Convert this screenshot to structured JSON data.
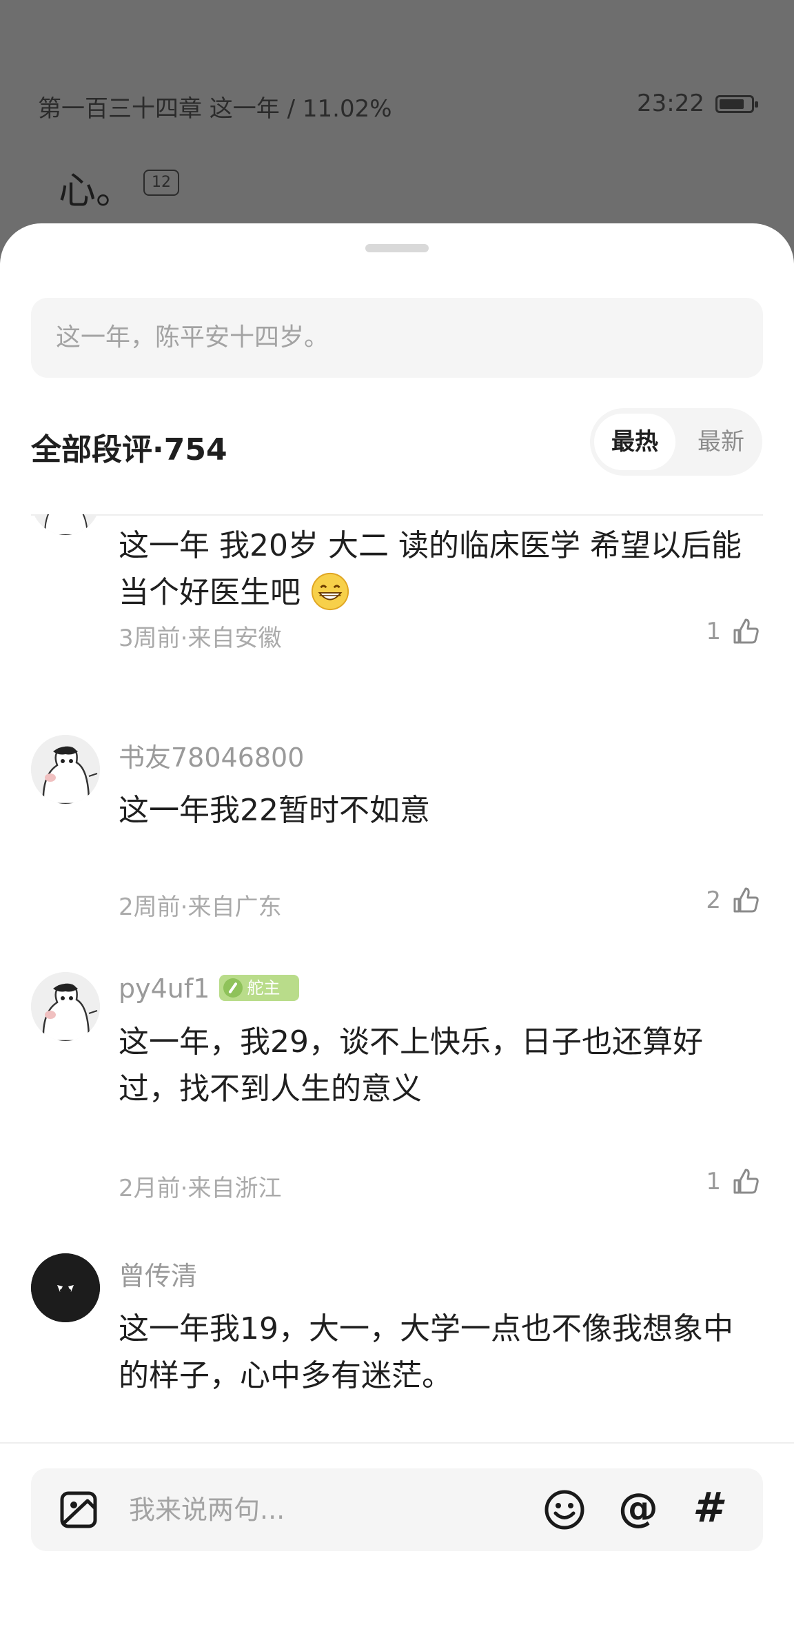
{
  "reader": {
    "chapter_progress": "第一百三十四章 这一年 / 11.02%",
    "time": "23:22",
    "battery_level": 0.8,
    "visible_line": "心。",
    "paragraph_comment_count": "12"
  },
  "sheet": {
    "quoted_text": "这一年，陈平安十四岁。",
    "section_title": "全部段评·754",
    "sort": {
      "hot": "最热",
      "new": "最新",
      "selected": "最热"
    }
  },
  "comments": [
    {
      "username": "",
      "text": "这一年 我20岁 大二 读的临床医学 希望以后能当个好医生吧",
      "emoji": "grinning-face",
      "meta": "3周前·来自安徽",
      "likes": "1"
    },
    {
      "username": "书友78046800",
      "text": "这一年我22暂时不如意",
      "meta": "2周前·来自广东",
      "likes": "2"
    },
    {
      "username": "py4uf1",
      "badge": "舵主",
      "text": "这一年，我29，谈不上快乐，日子也还算好过，找不到人生的意义",
      "meta": "2月前·来自浙江",
      "likes": "1"
    },
    {
      "username": "曾传清",
      "text": "这一年我19，大一，大学一点也不像我想象中的样子，心中多有迷茫。"
    }
  ],
  "input_bar": {
    "placeholder": "我来说两句...",
    "icons": [
      "image-icon",
      "emoji-icon",
      "mention-icon",
      "hashtag-icon"
    ],
    "at_symbol": "@",
    "hash_symbol": "#"
  }
}
